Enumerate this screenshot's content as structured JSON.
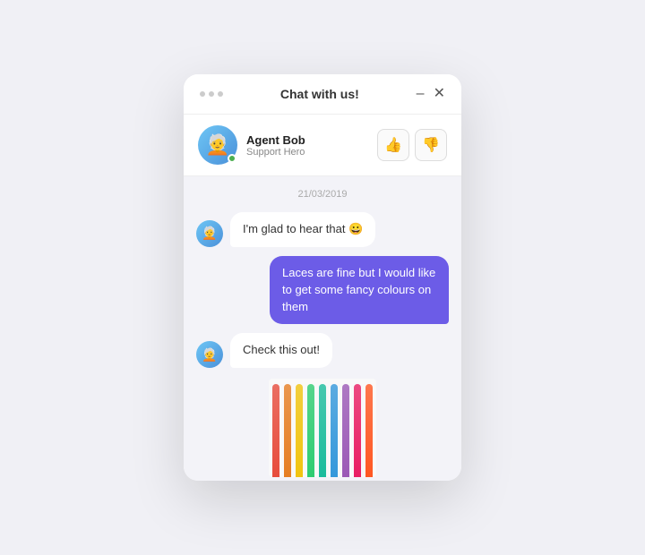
{
  "window": {
    "title": "Chat with us!",
    "minimize_label": "–",
    "close_label": "✕"
  },
  "agent": {
    "name": "Agent Bob",
    "role": "Support Hero",
    "avatar_emoji": "🧑‍🦳",
    "online": true
  },
  "rating": {
    "thumbs_up": "👍",
    "thumbs_down": "👎"
  },
  "chat": {
    "date": "21/03/2019",
    "messages": [
      {
        "type": "agent",
        "text": "I'm glad to hear that 😀"
      },
      {
        "type": "user",
        "text": "Laces are fine but I would like to get some fancy colours on them"
      },
      {
        "type": "agent",
        "text": "Check this out!"
      }
    ]
  },
  "laces": {
    "colors": [
      "#e74c3c",
      "#e67e22",
      "#f1c40f",
      "#2ecc71",
      "#1abc9c",
      "#3498db",
      "#9b59b6",
      "#e91e63",
      "#ff5722"
    ]
  }
}
